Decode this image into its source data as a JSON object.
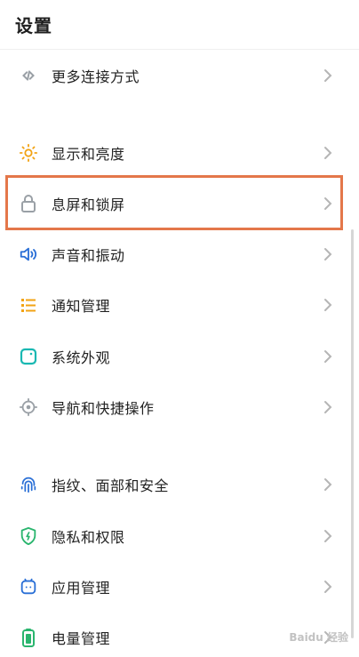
{
  "header": {
    "title": "设置"
  },
  "items": [
    {
      "label": "更多连接方式",
      "icon": "link-icon"
    },
    {
      "label": "显示和亮度",
      "icon": "sun-icon"
    },
    {
      "label": "息屏和锁屏",
      "icon": "lock-icon"
    },
    {
      "label": "声音和振动",
      "icon": "speaker-icon"
    },
    {
      "label": "通知管理",
      "icon": "notification-list-icon"
    },
    {
      "label": "系统外观",
      "icon": "theme-icon"
    },
    {
      "label": "导航和快捷操作",
      "icon": "navigation-icon"
    },
    {
      "label": "指纹、面部和安全",
      "icon": "fingerprint-icon"
    },
    {
      "label": "隐私和权限",
      "icon": "shield-icon"
    },
    {
      "label": "应用管理",
      "icon": "app-icon"
    },
    {
      "label": "电量管理",
      "icon": "battery-icon"
    }
  ],
  "colors": {
    "accent_orange": "#f2a314",
    "accent_teal": "#19b8b2",
    "accent_blue": "#2a6fd6",
    "accent_green": "#2ab56e",
    "icon_gray": "#9aa0a6",
    "highlight": "#e4774a"
  },
  "watermark": {
    "text": "Baidu 经验"
  }
}
